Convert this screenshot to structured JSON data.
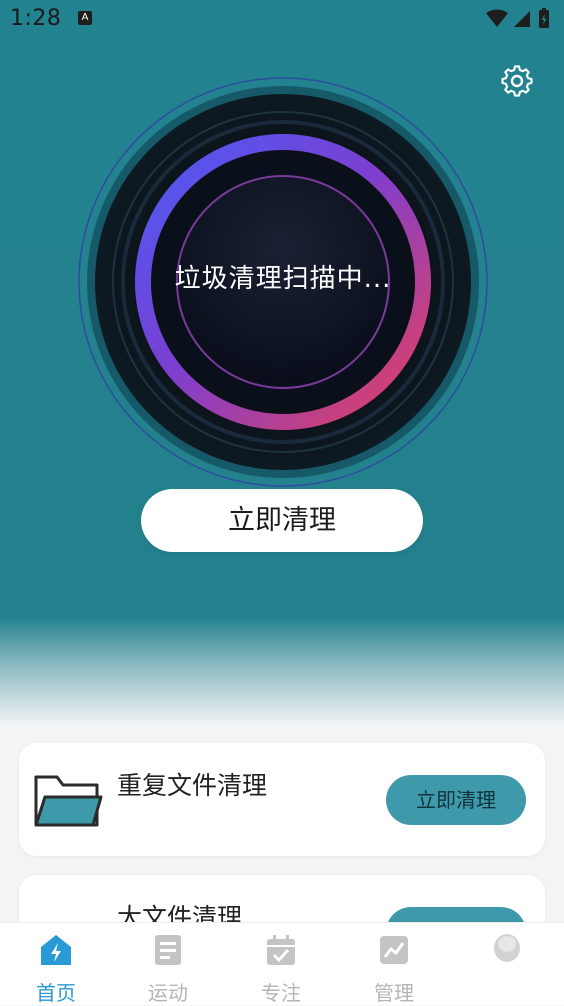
{
  "status_bar": {
    "time": "1:28",
    "badge": "A"
  },
  "header": {
    "settings_icon": "gear-icon"
  },
  "scanner": {
    "status_text": "垃圾清理扫描中...",
    "button_label": "立即清理"
  },
  "cards": [
    {
      "title": "重复文件清理",
      "button_label": "立即清理",
      "icon": "folder-icon"
    },
    {
      "title": "大文件清理",
      "button_label": "立即清理",
      "icon": "file-icon"
    }
  ],
  "tabs": [
    {
      "label": "首页",
      "icon": "home-bolt-icon",
      "active": true
    },
    {
      "label": "运动",
      "icon": "document-icon",
      "active": false
    },
    {
      "label": "专注",
      "icon": "calendar-check-icon",
      "active": false
    },
    {
      "label": "管理",
      "icon": "chart-icon",
      "active": false
    },
    {
      "label": "",
      "icon": "blob-icon",
      "active": false
    }
  ],
  "colors": {
    "hero_bg": "#23828f",
    "accent": "#3e9aaa",
    "tab_active": "#2a9ad6",
    "ring_start": "#4a5cf5",
    "ring_end": "#e8405d"
  }
}
